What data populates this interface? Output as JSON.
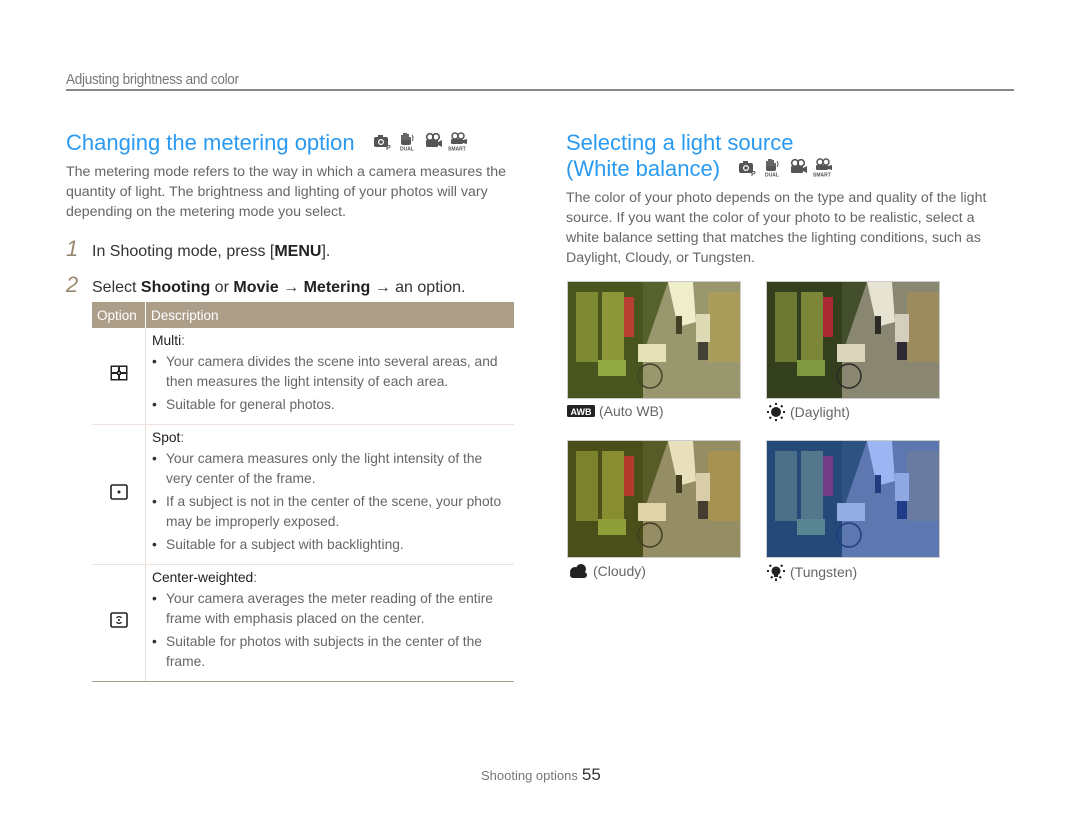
{
  "header": {
    "section_title": "Adjusting brightness and color"
  },
  "metering": {
    "title": "Changing the metering option",
    "mode_icons": [
      "program-mode-icon",
      "dual-is-mode-icon",
      "movie-mode-icon",
      "smart-movie-mode-icon"
    ],
    "intro": "The metering mode refers to the way in which a camera measures the quantity of light. The brightness and lighting of your photos will vary depending on the metering mode you select.",
    "steps": [
      {
        "num": "1",
        "prefix": "In Shooting mode, press [",
        "bold": "MENU",
        "suffix": "]."
      },
      {
        "num": "2",
        "text_1": "Select ",
        "bold_1": "Shooting",
        "text_2": " or ",
        "bold_2": "Movie",
        "text_3": " → ",
        "bold_3": "Metering",
        "text_4": " → an option."
      }
    ],
    "table": {
      "headers": [
        "Option",
        "Description"
      ],
      "rows": [
        {
          "icon": "multi-metering-icon",
          "name": "Multi",
          "bullets": [
            "Your camera divides the scene into several areas, and then measures the light intensity of each area.",
            "Suitable for general photos."
          ]
        },
        {
          "icon": "spot-metering-icon",
          "name": "Spot",
          "bullets": [
            "Your camera measures only the light intensity of the very center of the frame.",
            "If a subject is not in the center of the scene, your photo may be improperly exposed.",
            "Suitable for a subject with backlighting."
          ]
        },
        {
          "icon": "center-weighted-metering-icon",
          "name": "Center-weighted",
          "bullets": [
            "Your camera averages the meter reading of the entire frame with emphasis placed on the center.",
            "Suitable for photos with subjects in the center of the frame."
          ]
        }
      ]
    }
  },
  "white_balance": {
    "title_line1": "Selecting a light source",
    "title_line2": "(White balance)",
    "mode_icons": [
      "program-mode-icon",
      "dual-is-mode-icon",
      "movie-mode-icon",
      "smart-movie-mode-icon"
    ],
    "intro": "The color of your photo depends on the type and quality of the light source. If you want the color of your photo to be realistic, select a white balance setting that matches the lighting conditions, such as Daylight, Cloudy, or Tungsten.",
    "samples": [
      {
        "icon": "auto-wb-icon",
        "label": "(Auto WB)",
        "tint": "#c8c060"
      },
      {
        "icon": "daylight-icon",
        "label": "(Daylight)",
        "tint": "#b0a880"
      },
      {
        "icon": "cloudy-icon",
        "label": "(Cloudy)",
        "tint": "#c8b050"
      },
      {
        "icon": "tungsten-icon",
        "label": "(Tungsten)",
        "tint": "#3070e0"
      }
    ]
  },
  "footer": {
    "section": "Shooting options",
    "page": "55"
  },
  "colors": {
    "heading_blue": "#2a9af0",
    "table_header": "#ad9e89",
    "step_number": "#9a8770"
  }
}
